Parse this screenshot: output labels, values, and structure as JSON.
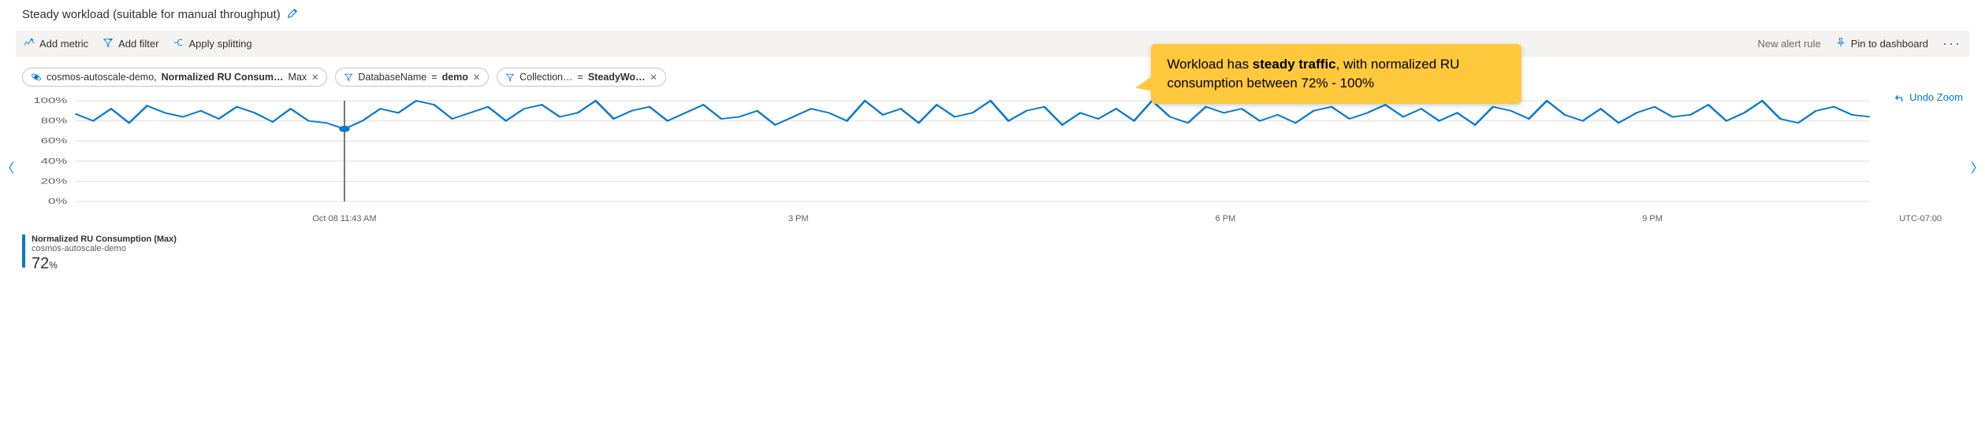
{
  "title": "Steady workload (suitable for manual throughput)",
  "toolbar": {
    "add_metric": "Add metric",
    "add_filter": "Add filter",
    "apply_splitting": "Apply splitting",
    "alert_rule": "New alert rule",
    "pin": "Pin to dashboard"
  },
  "chips": {
    "metric_resource": "cosmos-autoscale-demo,",
    "metric_name": "Normalized RU Consum…",
    "metric_agg": "Max",
    "filter1_key": "DatabaseName",
    "filter1_val": "demo",
    "filter2_key": "Collection…",
    "filter2_val": "SteadyWo…"
  },
  "undo_label": "Undo Zoom",
  "callout_pre": "Workload has ",
  "callout_bold": "steady traffic",
  "callout_post": ", with normalized RU consumption between 72% - 100%",
  "axis": {
    "y_ticks": [
      "0%",
      "20%",
      "40%",
      "60%",
      "80%",
      "100%"
    ],
    "x_ticks": [
      "Oct 08 11:43 AM",
      "3 PM",
      "6 PM",
      "9 PM"
    ],
    "tz": "UTC-07:00"
  },
  "legend": {
    "name": "Normalized RU Consumption (Max)",
    "resource": "cosmos-autoscale-demo",
    "value": "72",
    "unit": "%"
  },
  "chart_data": {
    "type": "line",
    "title": "Normalized RU Consumption (Max)",
    "xlabel": "",
    "ylabel": "",
    "ylim": [
      0,
      100
    ],
    "x_start": "Oct 08 11:43 AM",
    "x_tick_labels": [
      "Oct 08 11:43 AM",
      "3 PM",
      "6 PM",
      "9 PM"
    ],
    "timezone": "UTC-07:00",
    "cursor_index": 15,
    "cursor_value": 72,
    "series": [
      {
        "name": "Normalized RU Consumption (Max)",
        "color": "#0078d4",
        "values": [
          87,
          80,
          92,
          78,
          95,
          88,
          84,
          90,
          82,
          94,
          88,
          79,
          92,
          80,
          78,
          72,
          80,
          92,
          88,
          100,
          96,
          82,
          88,
          94,
          80,
          92,
          96,
          84,
          88,
          100,
          82,
          90,
          94,
          80,
          88,
          96,
          82,
          84,
          90,
          76,
          84,
          92,
          88,
          80,
          100,
          86,
          92,
          78,
          96,
          84,
          88,
          100,
          80,
          90,
          94,
          76,
          88,
          82,
          92,
          80,
          100,
          84,
          78,
          94,
          88,
          92,
          80,
          86,
          78,
          90,
          94,
          82,
          88,
          96,
          84,
          92,
          80,
          88,
          76,
          94,
          90,
          82,
          100,
          86,
          80,
          92,
          78,
          88,
          94,
          84,
          86,
          96,
          80,
          88,
          100,
          82,
          78,
          90,
          94,
          86,
          84
        ]
      }
    ]
  }
}
